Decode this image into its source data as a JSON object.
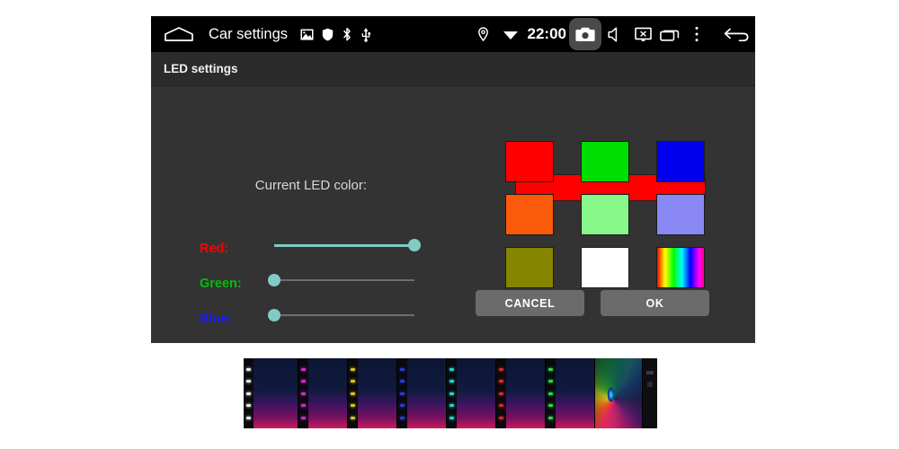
{
  "statusbar": {
    "home_icon": "home-icon",
    "app_title": "Car settings",
    "clock": "22:00",
    "system_icons": [
      {
        "name": "gallery-icon"
      },
      {
        "name": "shield-icon"
      },
      {
        "name": "bluetooth-icon"
      },
      {
        "name": "usb-icon"
      }
    ],
    "right_icons": [
      {
        "name": "location-icon"
      },
      {
        "name": "wifi-icon"
      }
    ],
    "nav_icons": [
      {
        "name": "camera-icon"
      },
      {
        "name": "volume-icon"
      },
      {
        "name": "screenshot-icon"
      },
      {
        "name": "recent-apps-icon"
      },
      {
        "name": "overflow-menu-icon"
      },
      {
        "name": "back-icon"
      }
    ]
  },
  "subheader": {
    "title": "LED settings"
  },
  "dialog": {
    "current_color_label": "Current LED color:",
    "current_color_value": "#ff0000",
    "sliders": [
      {
        "label": "Red:",
        "label_color": "#ff0000",
        "value": 100,
        "max": 100
      },
      {
        "label": "Green:",
        "label_color": "#00c000",
        "value": 0,
        "max": 100
      },
      {
        "label": "Blue:",
        "label_color": "#1a1aff",
        "value": 0,
        "max": 100
      }
    ],
    "slider_accent": "#80cbc4",
    "slider_track": "#6e6e6e",
    "swatches": [
      {
        "name": "swatch-red",
        "color": "#ff0000"
      },
      {
        "name": "swatch-green",
        "color": "#00dd00"
      },
      {
        "name": "swatch-blue",
        "color": "#0000ee"
      },
      {
        "name": "swatch-orange",
        "color": "#fa5a0a"
      },
      {
        "name": "swatch-lightgreen",
        "color": "#88f88a"
      },
      {
        "name": "swatch-periwinkle",
        "color": "#8a88f5"
      },
      {
        "name": "swatch-olive",
        "color": "#858500"
      },
      {
        "name": "swatch-white",
        "color": "#ffffff"
      },
      {
        "name": "swatch-rainbow",
        "color": "rainbow"
      }
    ],
    "cancel_label": "CANCEL",
    "ok_label": "OK"
  },
  "filmstrip": {
    "panels": [
      {
        "led_color": "#e8e8e8"
      },
      {
        "led_color": "#d22ad2"
      },
      {
        "led_color": "#d6c426"
      },
      {
        "led_color": "#2a3ad8"
      },
      {
        "led_color": "#2ad0d0"
      },
      {
        "led_color": "#d62a2a"
      },
      {
        "led_color": "#2ad64a"
      }
    ]
  }
}
